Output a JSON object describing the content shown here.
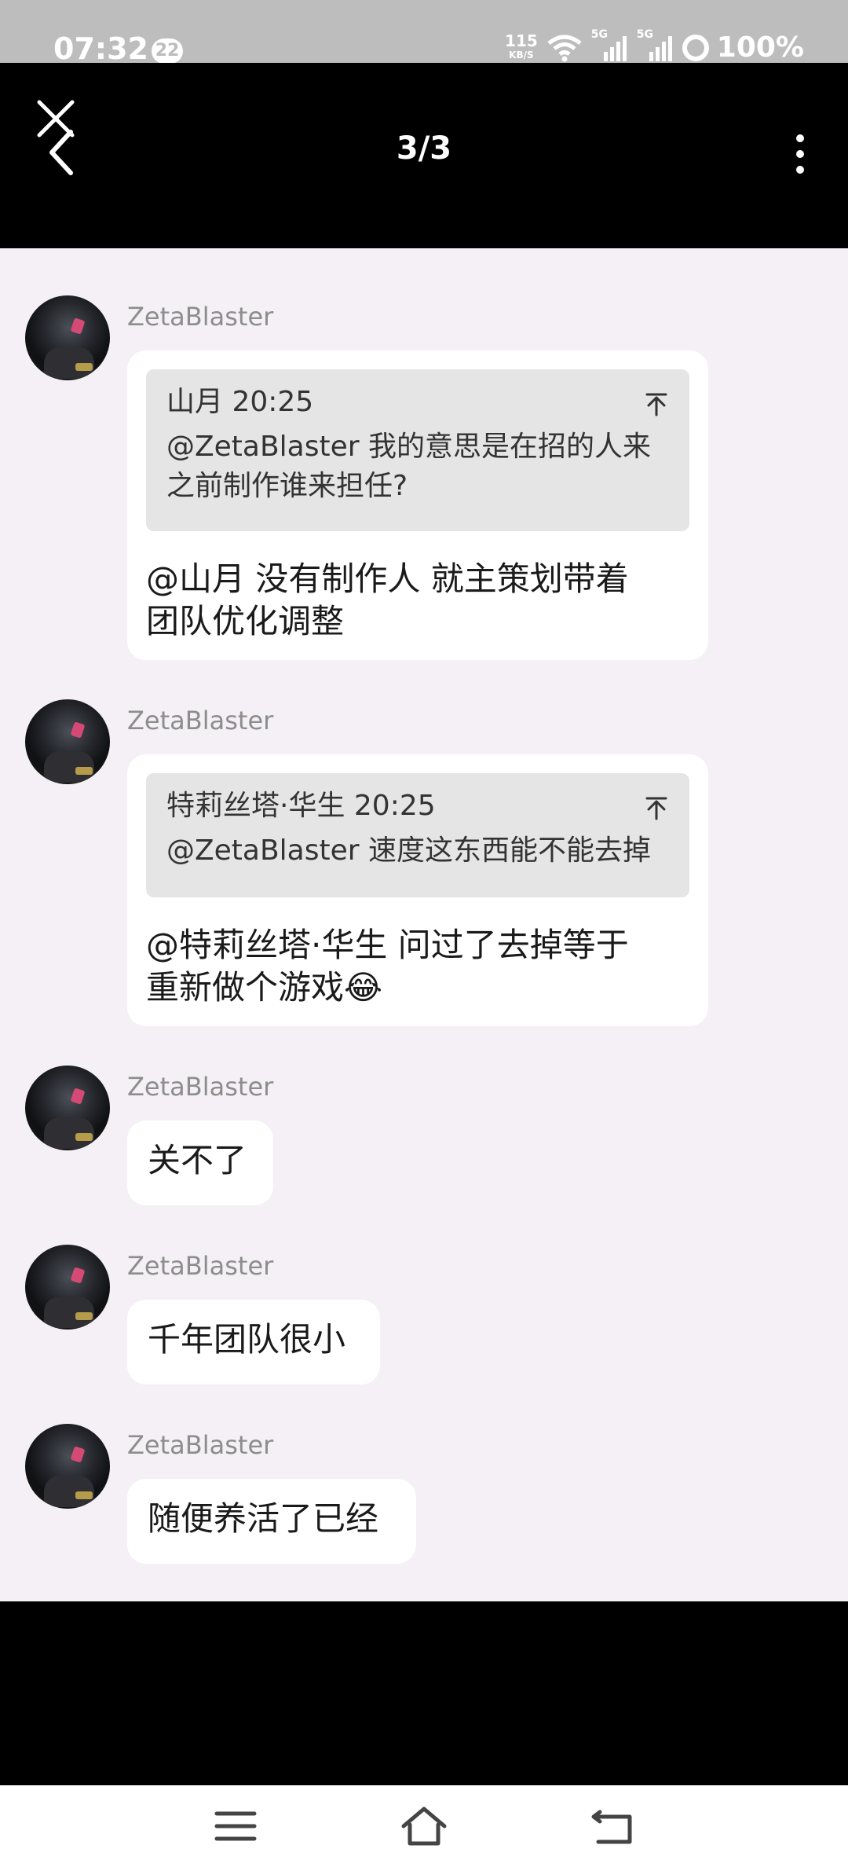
{
  "status_bar": {
    "time": "07:32",
    "notification_count": "22",
    "net_speed": "115",
    "net_unit": "KB/S",
    "signal_1": "5G",
    "signal_2": "5G",
    "battery": "100%"
  },
  "header": {
    "counter": "3/3"
  },
  "messages": [
    {
      "sender": "ZetaBlaster",
      "quote": {
        "author_time": "山月 20:25",
        "text_line1": "@ZetaBlaster 我的意思是在招的人来",
        "text_line2": "之前制作谁来担任?"
      },
      "text_line1": "@山月 没有制作人 就主策划带着",
      "text_line2": "团队优化调整"
    },
    {
      "sender": "ZetaBlaster",
      "quote": {
        "author_time": "特莉丝塔·华生 20:25",
        "text_line1": "@ZetaBlaster 速度这东西能不能去掉"
      },
      "text_line1": "@特莉丝塔·华生 问过了去掉等于",
      "text_line2": "重新做个游戏😂"
    },
    {
      "sender": "ZetaBlaster",
      "text_line1": "关不了"
    },
    {
      "sender": "ZetaBlaster",
      "text_line1": "千年团队很小"
    },
    {
      "sender": "ZetaBlaster",
      "text_line1": "随便养活了已经"
    }
  ],
  "colors": {
    "content_bg": "#f4f0f5",
    "bubble_bg": "#ffffff",
    "quote_bg": "#e5e5e5"
  },
  "icons": {
    "close": "close-icon",
    "back": "back-icon",
    "more": "more-vertical-icon",
    "pin": "pin-to-top-icon",
    "menu": "menu-icon",
    "home": "home-icon",
    "back_nav": "back-nav-icon"
  }
}
